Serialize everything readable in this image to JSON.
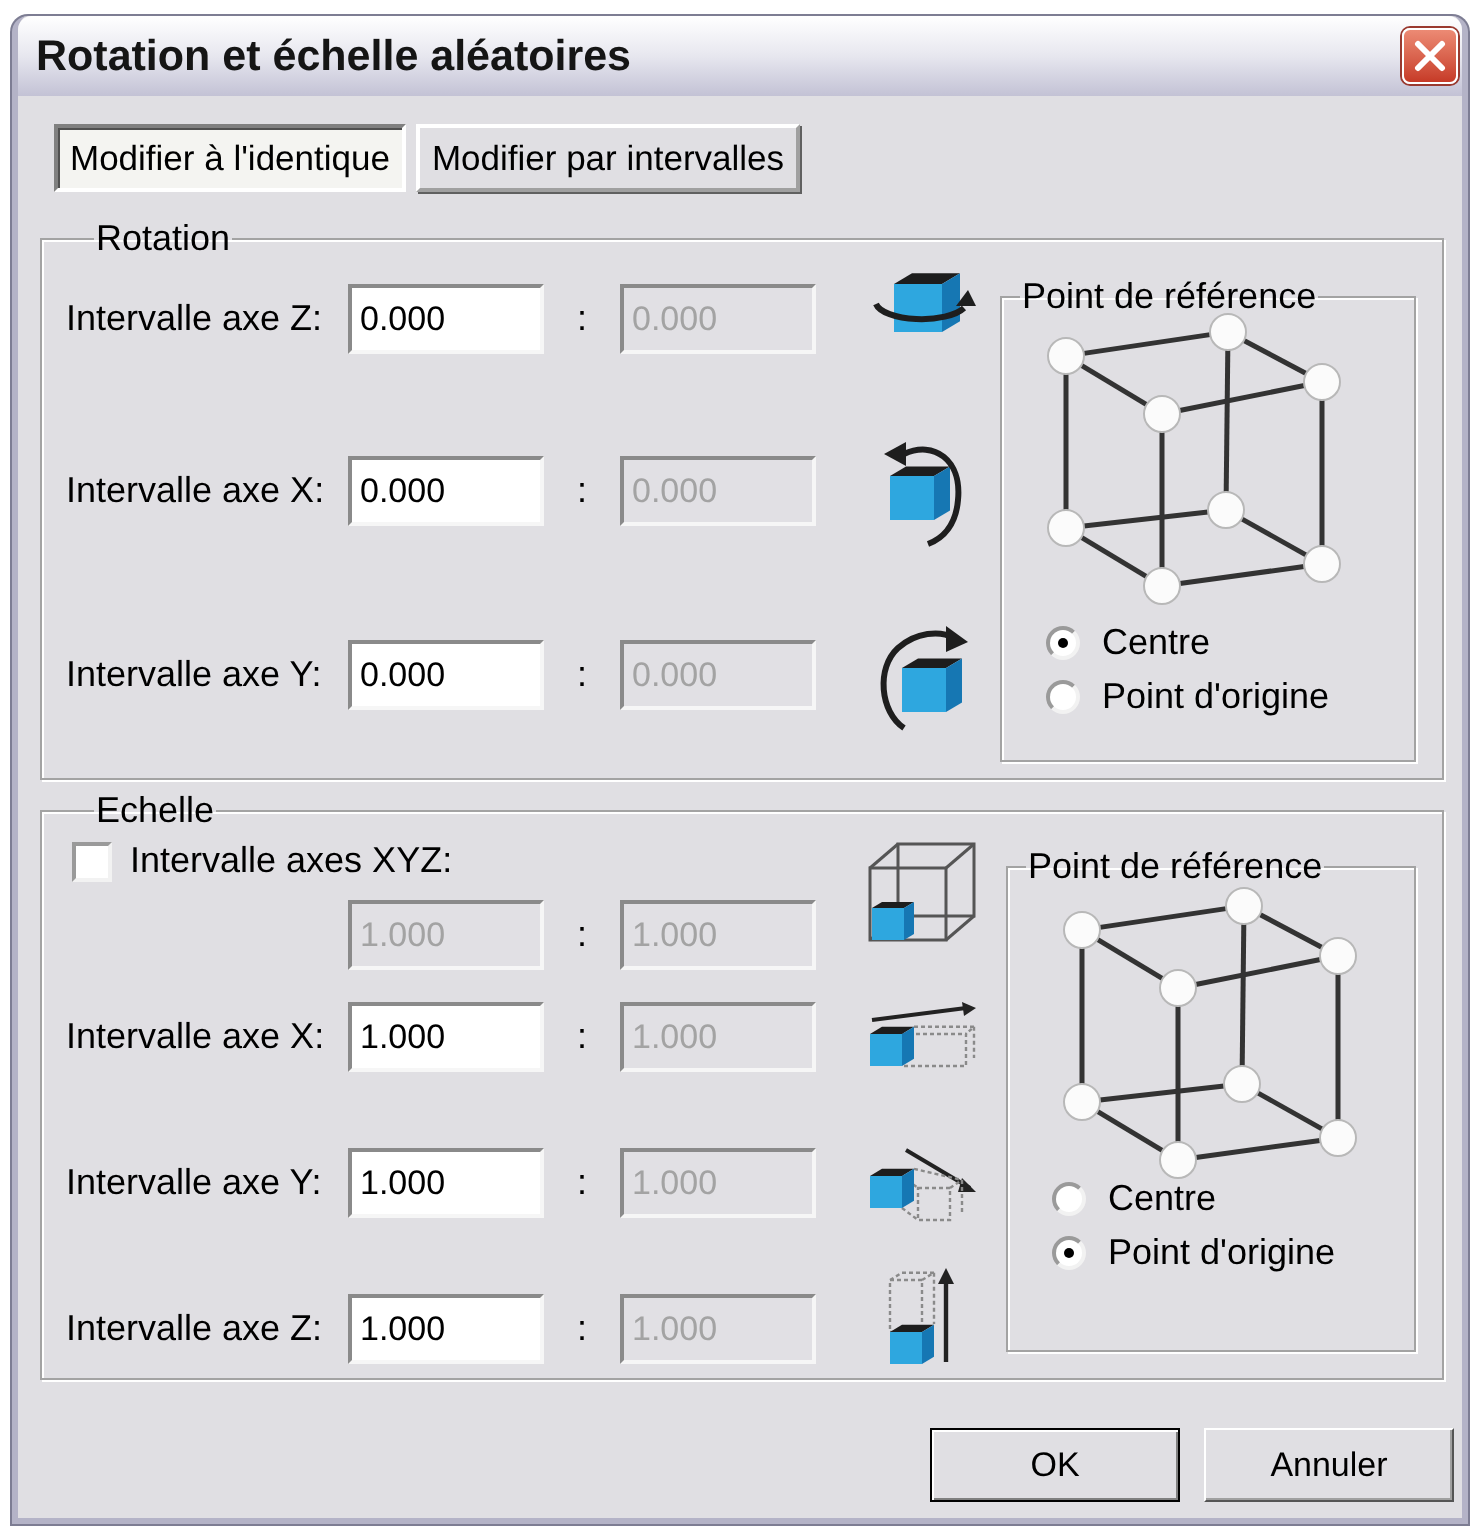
{
  "window": {
    "title": "Rotation et échelle aléatoires"
  },
  "mode_buttons": [
    {
      "label": "Modifier à l'identique",
      "selected": true
    },
    {
      "label": "Modifier par intervalles",
      "selected": false
    }
  ],
  "rotation": {
    "title": "Rotation",
    "rows": [
      {
        "kind": "rotate_z",
        "label": "Intervalle axe Z:",
        "from": {
          "value": "0.000",
          "disabled": false
        },
        "separator": ":",
        "to": {
          "value": "0.000",
          "disabled": true
        }
      },
      {
        "kind": "rotate_x",
        "label": "Intervalle axe X:",
        "from": {
          "value": "0.000",
          "disabled": false
        },
        "separator": ":",
        "to": {
          "value": "0.000",
          "disabled": true
        }
      },
      {
        "kind": "rotate_y",
        "label": "Intervalle axe Y:",
        "from": {
          "value": "0.000",
          "disabled": false
        },
        "separator": ":",
        "to": {
          "value": "0.000",
          "disabled": true
        }
      }
    ],
    "reference": {
      "title": "Point de référence",
      "options": [
        {
          "label": "Centre",
          "selected": true
        },
        {
          "label": "Point d'origine",
          "selected": false
        }
      ]
    }
  },
  "scale": {
    "title": "Echelle",
    "uniform": {
      "kind": "scale_xyz",
      "label": "Intervalle axes XYZ:",
      "checked": false,
      "from": {
        "value": "1.000",
        "disabled": true
      },
      "separator": ":",
      "to": {
        "value": "1.000",
        "disabled": true
      }
    },
    "rows": [
      {
        "kind": "scale_x",
        "label": "Intervalle axe X:",
        "from": {
          "value": "1.000",
          "disabled": false
        },
        "separator": ":",
        "to": {
          "value": "1.000",
          "disabled": true
        }
      },
      {
        "kind": "scale_y",
        "label": "Intervalle axe Y:",
        "from": {
          "value": "1.000",
          "disabled": false
        },
        "separator": ":",
        "to": {
          "value": "1.000",
          "disabled": true
        }
      },
      {
        "kind": "scale_z",
        "label": "Intervalle axe Z:",
        "from": {
          "value": "1.000",
          "disabled": false
        },
        "separator": ":",
        "to": {
          "value": "1.000",
          "disabled": true
        }
      }
    ],
    "reference": {
      "title": "Point de référence",
      "options": [
        {
          "label": "Centre",
          "selected": false
        },
        {
          "label": "Point d'origine",
          "selected": true
        }
      ]
    }
  },
  "buttons": [
    {
      "label": "OK",
      "default": true
    },
    {
      "label": "Annuler",
      "default": false
    }
  ]
}
